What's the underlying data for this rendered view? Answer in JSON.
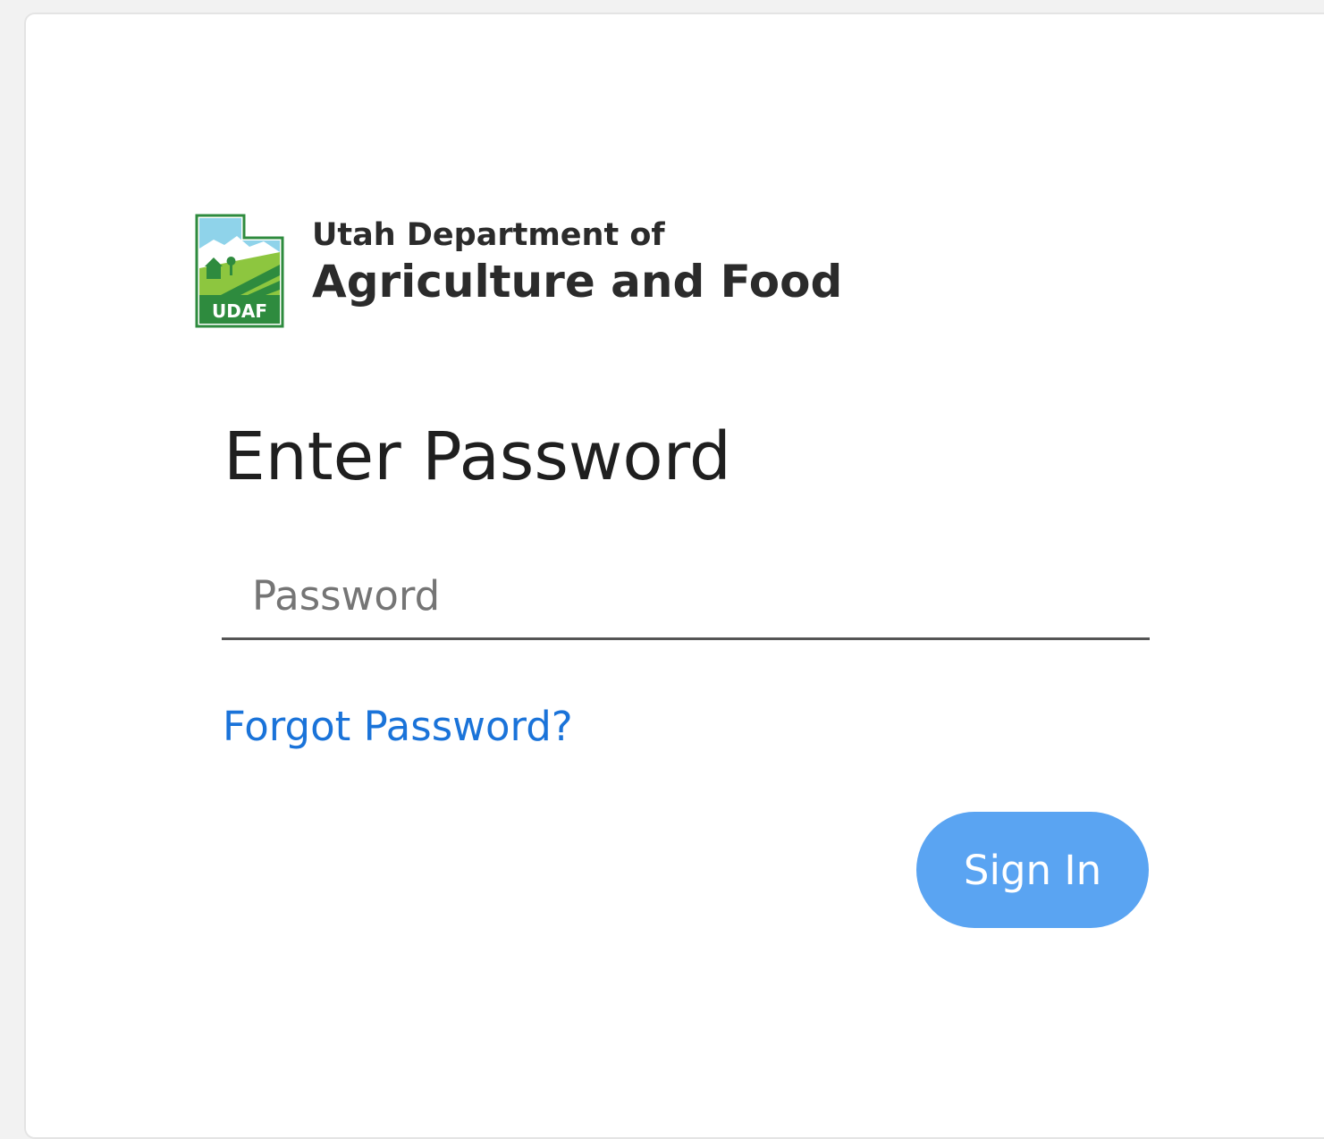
{
  "logo": {
    "badge_text": "UDAF",
    "line1": "Utah Department of",
    "line2": "Agriculture and Food",
    "colors": {
      "green": "#2e8b3e",
      "light_green": "#8dc63f",
      "sky": "#8fd3ea"
    }
  },
  "page_title": "Enter Password",
  "password_field": {
    "placeholder": "Password",
    "value": ""
  },
  "forgot_password_label": "Forgot Password?",
  "sign_in_label": "Sign In",
  "colors": {
    "link": "#1a73d9",
    "button": "#5aa4f2",
    "button_text": "#ffffff",
    "title": "#1f1f1f"
  }
}
